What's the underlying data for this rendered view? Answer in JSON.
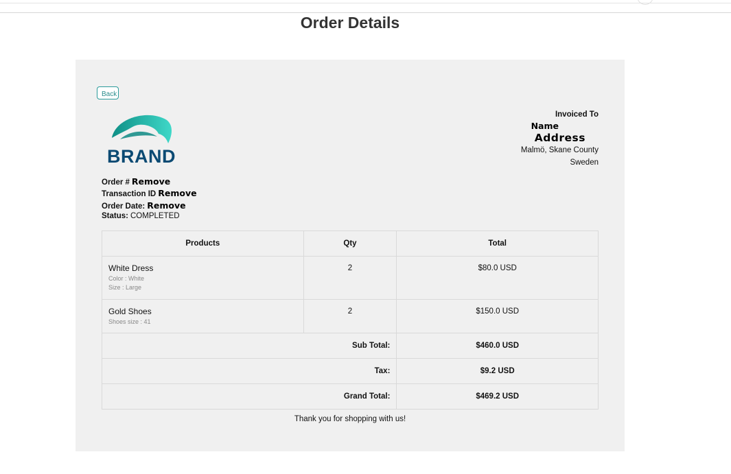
{
  "page": {
    "title": "Order Details"
  },
  "actions": {
    "back_label": "Back"
  },
  "brand": {
    "logo_text": "BRAND",
    "logo_colors": [
      "#1fb3a6",
      "#0b4a73"
    ]
  },
  "order": {
    "number_label": "Order #",
    "number_value": "Remove",
    "transaction_label": "Transaction ID",
    "transaction_value": "Remove",
    "date_label": "Order Date:",
    "date_value": "Remove",
    "status_label": "Status:",
    "status_value": "COMPLETED"
  },
  "invoice": {
    "label": "Invoiced To",
    "name": "Name",
    "address": "Address",
    "city": "Malmö, Skane County",
    "country": "Sweden"
  },
  "table": {
    "headers": {
      "products": "Products",
      "qty": "Qty",
      "total": "Total"
    },
    "rows": [
      {
        "name": "White Dress",
        "options": [
          "Color : White",
          "Size : Large"
        ],
        "qty": "2",
        "total": "$80.0 USD"
      },
      {
        "name": "Gold Shoes",
        "options": [
          "Shoes size : 41"
        ],
        "qty": "2",
        "total": "$150.0 USD"
      }
    ],
    "summary": {
      "subtotal_label": "Sub Total:",
      "subtotal_value": "$460.0 USD",
      "tax_label": "Tax:",
      "tax_value": "$9.2 USD",
      "grand_label": "Grand Total:",
      "grand_value": "$469.2 USD"
    }
  },
  "footer": {
    "thanks": "Thank you for shopping with us!"
  }
}
